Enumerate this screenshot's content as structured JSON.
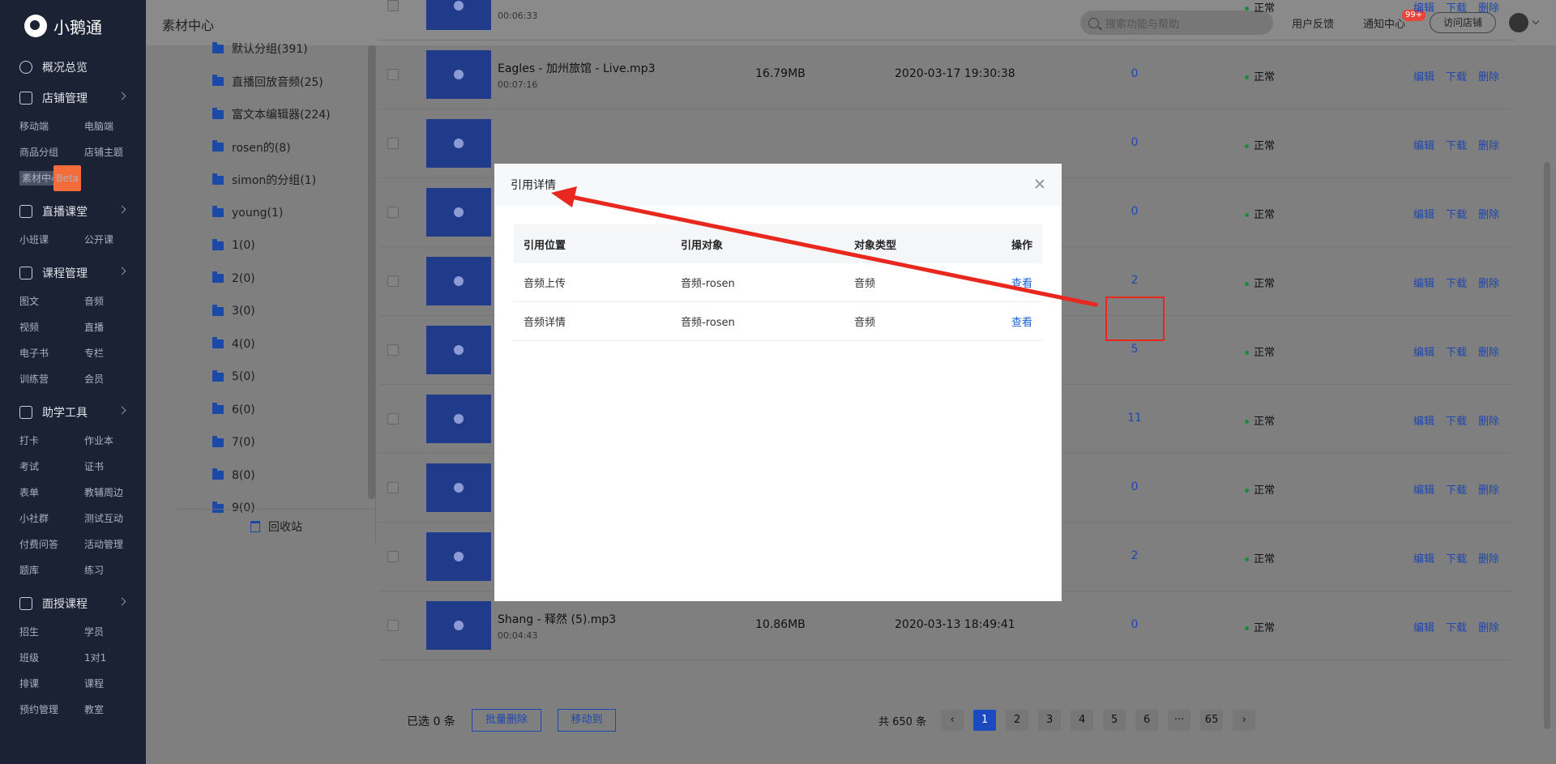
{
  "app": {
    "logo": "小鹅通",
    "page_title": "素材中心",
    "search_placeholder": "搜索功能与帮助",
    "feedback": "用户反馈",
    "notice": "通知中心",
    "notice_badge": "99+",
    "visit_store": "访问店铺"
  },
  "sidebar": {
    "overview": "概况总览",
    "sections": [
      {
        "title": "店铺管理",
        "items": [
          "移动端",
          "电脑端",
          "商品分组",
          "店铺主题",
          "素材中心"
        ],
        "active_index": 4,
        "active_badge": "Beta"
      },
      {
        "title": "直播课堂",
        "items": [
          "小班课",
          "公开课"
        ]
      },
      {
        "title": "课程管理",
        "items": [
          "图文",
          "音频",
          "视频",
          "直播",
          "电子书",
          "专栏",
          "训练营",
          "会员"
        ]
      },
      {
        "title": "助学工具",
        "items": [
          "打卡",
          "作业本",
          "考试",
          "证书",
          "表单",
          "教辅周边",
          "小社群",
          "测试互动",
          "付费问答",
          "活动管理",
          "题库",
          "练习"
        ]
      },
      {
        "title": "面授课程",
        "items": [
          "招生",
          "学员",
          "班级",
          "1对1",
          "排课",
          "课程",
          "预约管理",
          "教室"
        ]
      }
    ]
  },
  "folders": {
    "items": [
      "默认分组(391)",
      "直播回放音频(25)",
      "富文本编辑器(224)",
      "rosen的(8)",
      "simon的分组(1)",
      "young(1)",
      "1(0)",
      "2(0)",
      "3(0)",
      "4(0)",
      "5(0)",
      "6(0)",
      "7(0)",
      "8(0)",
      "9(0)"
    ],
    "recycle": "回收站"
  },
  "table": {
    "status_text": "正常",
    "actions": [
      "编辑",
      "下载",
      "删除"
    ],
    "rows": [
      {
        "name": "",
        "duration": "00:06:33",
        "size": "",
        "time": "",
        "count": ""
      },
      {
        "name": "Eagles - 加州旅馆 - Live.mp3",
        "duration": "00:07:16",
        "size": "16.79MB",
        "time": "2020-03-17 19:30:38",
        "count": "0"
      },
      {
        "name": "",
        "duration": "",
        "size": "",
        "time": "",
        "count": "0"
      },
      {
        "name": "",
        "duration": "",
        "size": "",
        "time": "",
        "count": "0"
      },
      {
        "name": "",
        "duration": "",
        "size": "",
        "time": "",
        "count": "2"
      },
      {
        "name": "",
        "duration": "",
        "size": "",
        "time": "",
        "count": "5"
      },
      {
        "name": "",
        "duration": "",
        "size": "",
        "time": "",
        "count": "11"
      },
      {
        "name": "",
        "duration": "",
        "size": "",
        "time": "",
        "count": "0"
      },
      {
        "name": "",
        "duration": "",
        "size": "",
        "time": "",
        "count": "2"
      },
      {
        "name": "Shang - 释然 (5).mp3",
        "duration": "00:04:43",
        "size": "10.86MB",
        "time": "2020-03-13 18:49:41",
        "count": "0"
      }
    ]
  },
  "footer": {
    "selected": "已选 0 条",
    "batch_delete": "批量删除",
    "move_to": "移动到",
    "total": "共 650 条",
    "pages": [
      "1",
      "2",
      "3",
      "4",
      "5",
      "6",
      "···",
      "65"
    ],
    "current_page": "1"
  },
  "modal": {
    "title": "引用详情",
    "headers": [
      "引用位置",
      "引用对象",
      "对象类型",
      "操作"
    ],
    "rows": [
      {
        "location": "音频上传",
        "object": "音频-rosen",
        "type": "音频",
        "action": "查看"
      },
      {
        "location": "音频详情",
        "object": "音频-rosen",
        "type": "音频",
        "action": "查看"
      }
    ]
  },
  "colors": {
    "sidebar_bg": "#1b2233",
    "link_blue": "#1e5fd8",
    "annotation_red": "#e8281e"
  }
}
